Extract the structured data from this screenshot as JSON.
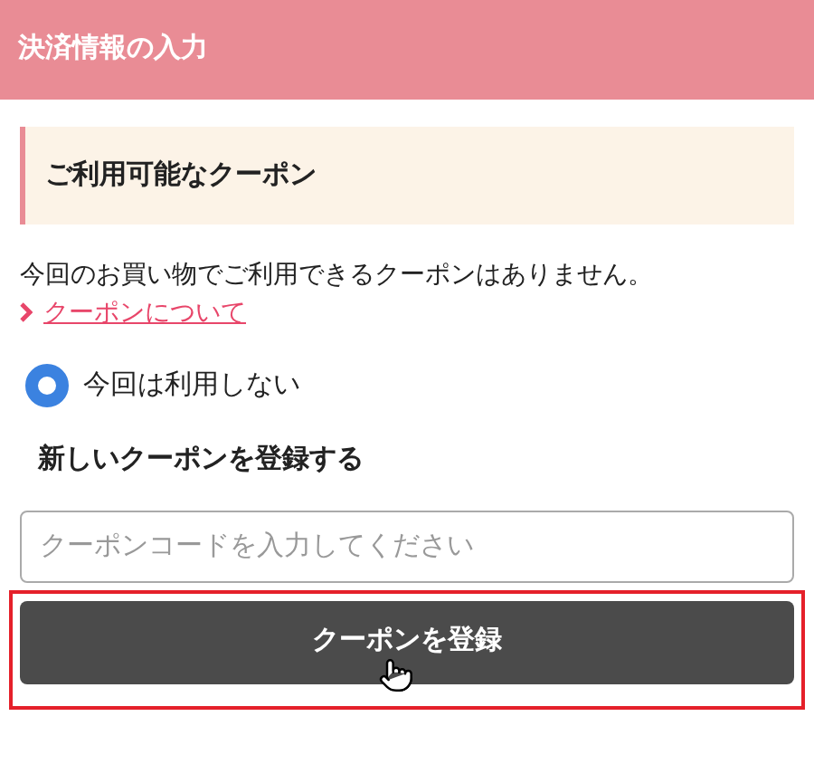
{
  "header": {
    "title": "決済情報の入力"
  },
  "coupon_section": {
    "title": "ご利用可能なクーポン",
    "message": "今回のお買い物でご利用できるクーポンはありません。",
    "link": "クーポンについて"
  },
  "options": [
    {
      "label": "今回は利用しない",
      "selected": true
    }
  ],
  "register": {
    "title": "新しいクーポンを登録する",
    "placeholder": "クーポンコードを入力してください",
    "button": "クーポンを登録",
    "highlighted": true
  }
}
